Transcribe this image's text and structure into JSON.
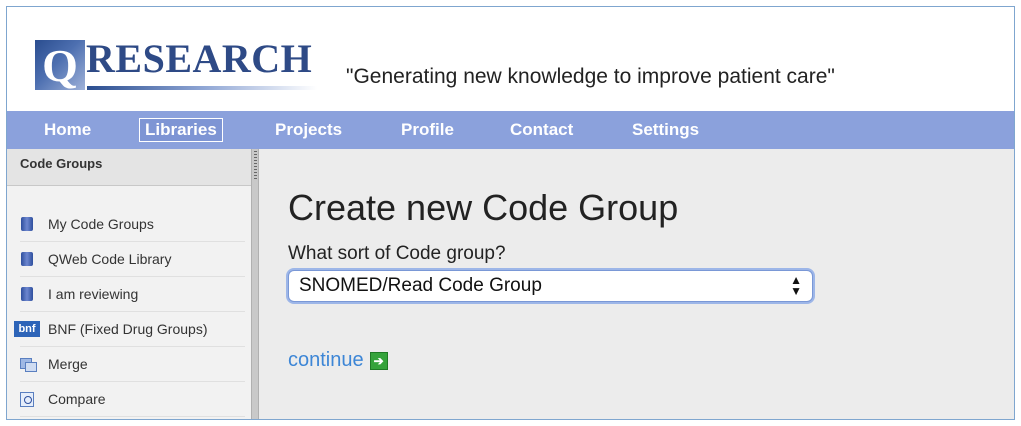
{
  "header": {
    "logo_q": "Q",
    "logo_text": "RESEARCH",
    "tagline": "\"Generating new knowledge to improve patient care\""
  },
  "nav": {
    "items": [
      {
        "label": "Home"
      },
      {
        "label": "Libraries",
        "active": true
      },
      {
        "label": "Projects"
      },
      {
        "label": "Profile"
      },
      {
        "label": "Contact"
      },
      {
        "label": "Settings"
      }
    ]
  },
  "sidebar": {
    "title": "Code Groups",
    "items": [
      {
        "label": "My Code Groups",
        "icon": "database-icon"
      },
      {
        "label": "QWeb Code Library",
        "icon": "database-icon"
      },
      {
        "label": "I am reviewing",
        "icon": "database-icon"
      },
      {
        "label": "BNF (Fixed Drug Groups)",
        "icon": "bnf-icon",
        "icon_text": "bnf"
      },
      {
        "label": "Merge",
        "icon": "merge-icon"
      },
      {
        "label": "Compare",
        "icon": "compare-icon"
      }
    ]
  },
  "main": {
    "title": "Create new Code Group",
    "question": "What sort of Code group?",
    "select_value": "SNOMED/Read Code Group",
    "continue_label": "continue"
  },
  "colors": {
    "nav_bg": "#8ba1dc",
    "logo_blue": "#2e4a86",
    "link_blue": "#3d86d6",
    "go_green": "#35a33b"
  }
}
